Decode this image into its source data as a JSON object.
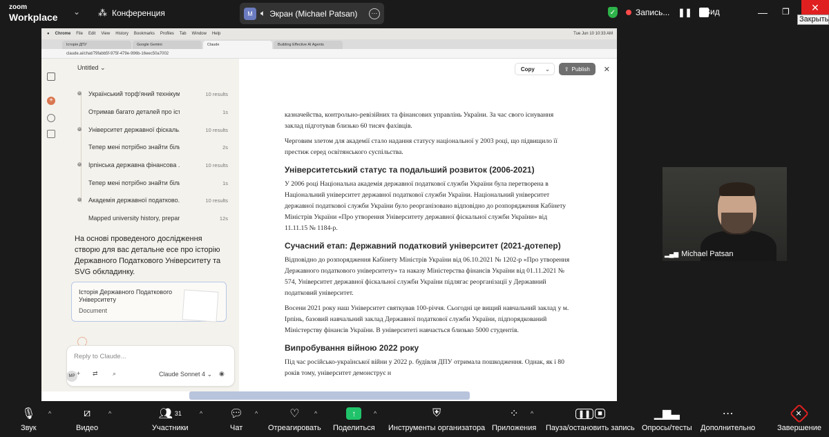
{
  "zoom": {
    "logo_line1": "zoom",
    "logo_line2": "Workplace",
    "meeting_name": "Конференция",
    "share_label": "Экран (Michael Patsan)",
    "record_label": "Запись...",
    "view_label": "Вид",
    "close_tooltip": "Закрыть",
    "participants_count": "31",
    "toolbar": [
      "Звук",
      "Видео",
      "Участники",
      "Чат",
      "Отреагировать",
      "Поделиться",
      "Инструменты организатора",
      "Приложения",
      "Пауза/остановить запись",
      "Опросы/тесты",
      "Дополнительно",
      "Завершение"
    ],
    "video_name": "Michael Patsan"
  },
  "browser": {
    "mac_menu": [
      "Chrome",
      "File",
      "Edit",
      "View",
      "History",
      "Bookmarks",
      "Profiles",
      "Tab",
      "Window",
      "Help"
    ],
    "clock": "Tue Jun 10  10:33 AM",
    "tabs": [
      "Історія ДПУ",
      "Google Gemini",
      "Claude",
      "Building Effective AI Agents"
    ],
    "url": "claude.ai/chat/79fabb5f-975f-479e-996b-16eec50a7002"
  },
  "claude": {
    "title": "Untitled",
    "steps": [
      {
        "icon": "globe",
        "text": "Український торф'яний технікум...",
        "right": "10 results"
      },
      {
        "icon": "none",
        "text": "Отримав багато деталей про історію",
        "right": "1s"
      },
      {
        "icon": "globe",
        "text": "Університет державної фіскаль...",
        "right": "10 results"
      },
      {
        "icon": "none",
        "text": "Тепер мені потрібно знайти більше інформації",
        "right": "2s"
      },
      {
        "icon": "globe",
        "text": "Ірпінська державна фінансова ...",
        "right": "10 results"
      },
      {
        "icon": "none",
        "text": "Тепер мені потрібно знайти більше к",
        "right": "1s"
      },
      {
        "icon": "globe",
        "text": "Академія державної податково...",
        "right": "10 results"
      },
      {
        "icon": "none",
        "text": "Mapped university history, prepared",
        "right": "12s"
      }
    ],
    "answer": "На основі проведеного дослідження створю для вас детальне есе про історію Державного Податкового Університету та SVG обкладинку.",
    "doc_title": "Історія Державного Податкового Університету",
    "doc_kind": "Document",
    "reply_placeholder": "Reply to Claude...",
    "model": "Claude Sonnet 4",
    "avatar": "MP",
    "copy_label": "Copy",
    "publish_label": "Publish"
  },
  "article": {
    "p0": "казначейства, контрольно-ревізійних та фінансових управлінь України. За час свого існування заклад підготував близько 60 тисяч фахівців.",
    "p1": "Черговим злетом для академії стало надання статусу національної у 2003 році, що підвищило її престиж серед освітянського суспільства.",
    "h1": "Університетський статус та подальший розвиток (2006-2021)",
    "p2": "У 2006 році Національна академія державної податкової служби України була перетворена в Національний університет державної податкової служби України. Національний університет державної податкової служби України було реорганізовано відповідно до розпорядження Кабінету Міністрів України «Про утворення Університету державної фіскальної служби України» від 11.11.15 № 1184-р.",
    "h2": "Сучасний етап: Державний податковий університет (2021-дотепер)",
    "p3": "Відповідно до розпорядження Кабінету Міністрів України від 06.10.2021 № 1202-р «Про утворення Державного податкового університету» та наказу Міністерства фінансів України від 01.11.2021 № 574, Університет державної фіскальної служби України підлягає реорганізації у Державний податковий університет.",
    "p4": "Восени 2021 року наш Університет святкував 100-річчя. Сьогодні це вищий навчальний заклад у м. Ірпінь, базовий навчальний заклад Державної податкової служби України, підпорядкований Міністерству фінансів України. В університеті навчається близько 5000 студентів.",
    "h3": "Випробування війною 2022 року",
    "p5": "Під час російсько-української війни у 2022 р. будівля ДПУ отримала пошкодження. Однак, як і 80 років тому, університет демонструє н"
  }
}
